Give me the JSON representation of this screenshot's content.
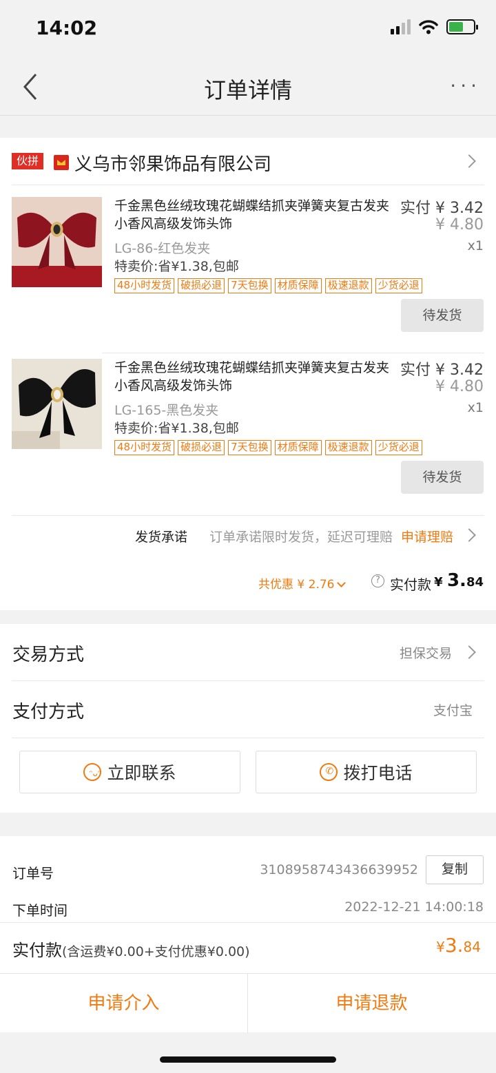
{
  "status_bar": {
    "time": "14:02"
  },
  "nav": {
    "title": "订单详情",
    "more": "···"
  },
  "store": {
    "partner_tag": "伙拼",
    "name": "义乌市邻果饰品有限公司"
  },
  "products": [
    {
      "title": "千金黑色丝绒玫瑰花蝴蝶结抓夹弹簧夹复古发夹小香风高级发饰头饰",
      "paid": "实付 ¥ 3.42",
      "original": "¥ 4.80",
      "qty": "x1",
      "sku": "LG-86-红色发夹",
      "special": "特卖价:省¥1.38,包邮",
      "badges": [
        "48小时发货",
        "破损必退",
        "7天包换",
        "材质保障",
        "极速退款",
        "少货必退"
      ],
      "status": "待发货",
      "color": "#8e1520"
    },
    {
      "title": "千金黑色丝绒玫瑰花蝴蝶结抓夹弹簧夹复古发夹小香风高级发饰头饰",
      "paid": "实付 ¥ 3.42",
      "original": "¥ 4.80",
      "qty": "x1",
      "sku": "LG-165-黑色发夹",
      "special": "特卖价:省¥1.38,包邮",
      "badges": [
        "48小时发货",
        "破损必退",
        "7天包换",
        "材质保障",
        "极速退款",
        "少货必退"
      ],
      "status": "待发货",
      "color": "#141414"
    }
  ],
  "promise": {
    "label": "发货承诺",
    "text": "订单承诺限时发货，延迟可理赔",
    "link": "申请理赔"
  },
  "totals": {
    "discount": "共优惠 ¥ 2.76",
    "label": "实付款",
    "currency": "¥",
    "int": "3.",
    "dec": "84"
  },
  "trade": {
    "label": "交易方式",
    "value": "担保交易"
  },
  "payment": {
    "label": "支付方式",
    "value": "支付宝"
  },
  "contact": {
    "chat": "立即联系",
    "call": "拨打电话"
  },
  "order": {
    "id_label": "订单号",
    "id": "3108958743436639952",
    "copy": "复制",
    "time_label": "下单时间",
    "time": "2022-12-21 14:00:18"
  },
  "paid": {
    "label": "实付款",
    "detail": "(含运费¥0.00+支付优惠¥0.00)",
    "currency": "¥",
    "int": "3.",
    "dec": "84"
  },
  "bottom": {
    "intervene": "申请介入",
    "refund": "申请退款"
  },
  "colors": {
    "accent": "#f07a10",
    "red_tag": "#e02e24",
    "bg": "#f2f2f2"
  }
}
